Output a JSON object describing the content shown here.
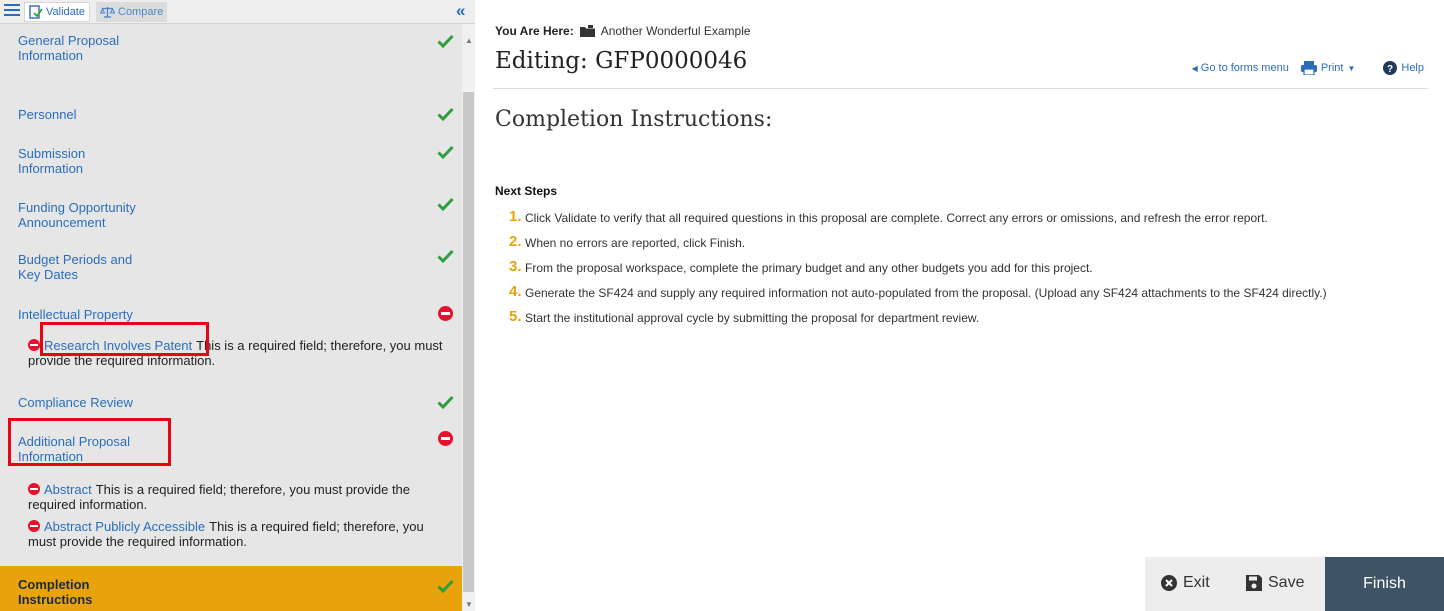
{
  "toolbar": {
    "validate_label": "Validate",
    "compare_label": "Compare"
  },
  "sidebar": {
    "items": [
      {
        "label": "General Proposal Information",
        "status": "complete"
      },
      {
        "label": "Personnel",
        "status": "complete"
      },
      {
        "label": "Submission Information",
        "status": "complete"
      },
      {
        "label": "Funding Opportunity Announcement",
        "status": "complete"
      },
      {
        "label": "Budget Periods and Key Dates",
        "status": "complete"
      },
      {
        "label": "Intellectual Property",
        "status": "error"
      },
      {
        "label": "Compliance Review",
        "status": "complete"
      },
      {
        "label": "Additional Proposal Information",
        "status": "error"
      },
      {
        "label": "Completion Instructions",
        "status": "complete"
      }
    ],
    "errors": {
      "ip_patent": {
        "field": "Research Involves Patent",
        "message": "This is a required field; therefore, you must provide the required information."
      },
      "abstract": {
        "field": "Abstract",
        "message": "This is a required field; therefore, you must provide the required information."
      },
      "abstract_public": {
        "field": "Abstract Publicly Accessible",
        "message": "This is a required field; therefore, you must provide the required information."
      }
    }
  },
  "breadcrumb": {
    "prefix": "You Are Here:",
    "location": "Another Wonderful Example"
  },
  "header": {
    "title": "Editing: GFP0000046",
    "forms_menu": "Go to forms menu",
    "print": "Print",
    "help": "Help"
  },
  "content": {
    "section_title": "Completion Instructions:",
    "next_steps_heading": "Next Steps",
    "steps": [
      {
        "num": "1.",
        "text": "Click Validate to verify that all required questions in this proposal are complete. Correct any errors or omissions, and refresh the error report."
      },
      {
        "num": "2.",
        "text": "When no errors are reported, click Finish."
      },
      {
        "num": "3.",
        "text": "From the proposal workspace, complete the primary budget and any other budgets you add for this project."
      },
      {
        "num": "4.",
        "text": "Generate the SF424 and supply any required information not auto-populated from the proposal. (Upload any SF424 attachments to the SF424 directly.)"
      },
      {
        "num": "5.",
        "text": "Start the institutional approval cycle by submitting the proposal for department review."
      }
    ]
  },
  "footer": {
    "exit_label": "Exit",
    "save_label": "Save",
    "finish_label": "Finish"
  },
  "colors": {
    "link": "#2a6ebb",
    "success": "#2e9e3e",
    "error": "#e8112d",
    "highlight": "#e8a30c",
    "finish_bg": "#3e5466"
  },
  "icons": {
    "menu": "hamburger-icon",
    "validate": "validate-icon",
    "compare": "balance-scale-icon",
    "collapse": "double-chevron-left-icon",
    "complete": "check-icon",
    "error": "no-entry-icon",
    "breadcrumb": "folder-icon",
    "exit": "times-circle-icon",
    "save": "floppy-disk-icon",
    "print": "printer-icon",
    "help": "question-circle-icon"
  }
}
